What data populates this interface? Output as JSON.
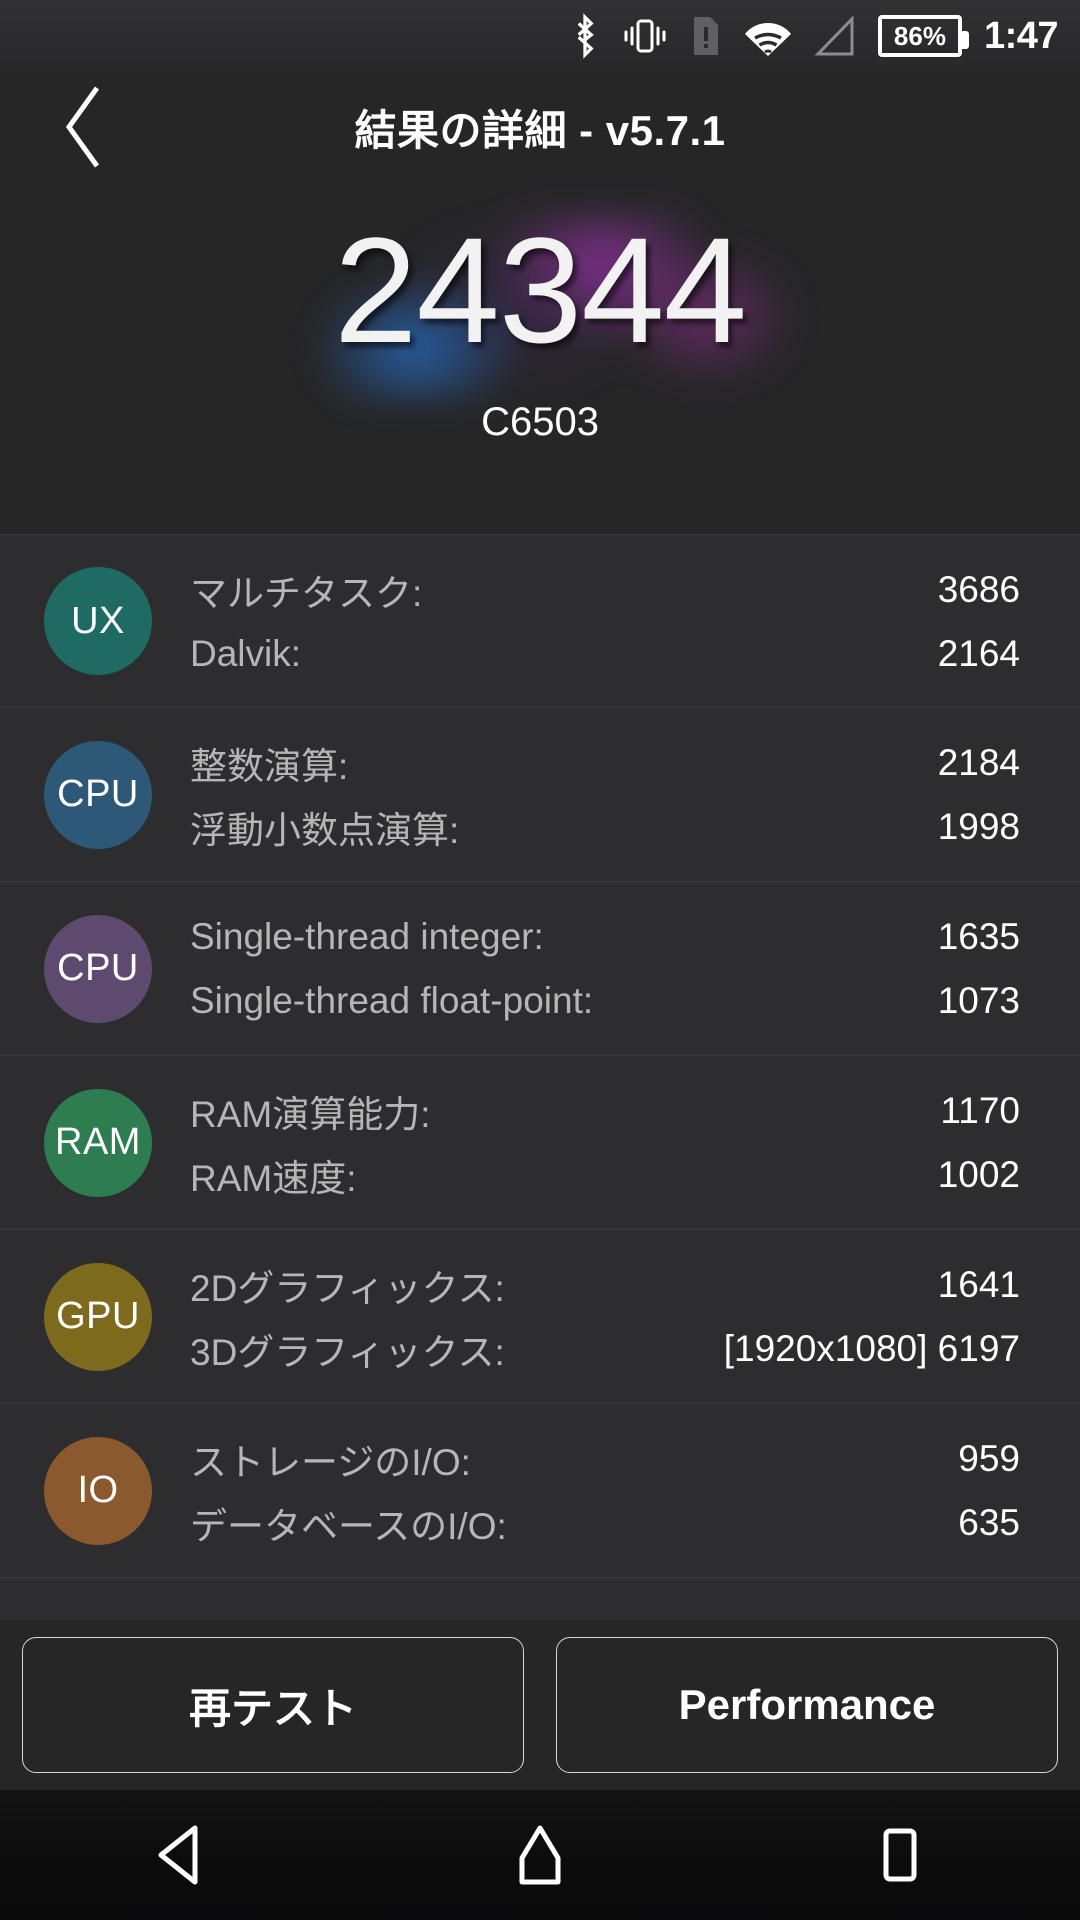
{
  "statusbar": {
    "icons": [
      "bluetooth-icon",
      "vibrate-icon",
      "sim-alert-icon",
      "wifi-icon",
      "signal-icon"
    ],
    "battery_percent": "86%",
    "clock": "1:47"
  },
  "header": {
    "back_label": "戻る",
    "title": "結果の詳細 - v5.7.1"
  },
  "hero": {
    "score": "24344",
    "device": "C6503",
    "glow_colors": [
      "#2660a8",
      "#80308c"
    ]
  },
  "results": [
    {
      "badge": "UX",
      "badge_color": "#1f6b63",
      "lines": [
        {
          "label": "マルチタスク:",
          "value": "3686"
        },
        {
          "label": "Dalvik:",
          "value": "2164"
        }
      ]
    },
    {
      "badge": "CPU",
      "badge_color": "#2e5878",
      "lines": [
        {
          "label": "整数演算:",
          "value": "2184"
        },
        {
          "label": "浮動小数点演算:",
          "value": "1998"
        }
      ]
    },
    {
      "badge": "CPU",
      "badge_color": "#5e4a6e",
      "lines": [
        {
          "label": "Single-thread integer:",
          "value": "1635"
        },
        {
          "label": "Single-thread float-point:",
          "value": "1073"
        }
      ]
    },
    {
      "badge": "RAM",
      "badge_color": "#2e7d51",
      "lines": [
        {
          "label": "RAM演算能力:",
          "value": "1170"
        },
        {
          "label": "RAM速度:",
          "value": "1002"
        }
      ]
    },
    {
      "badge": "GPU",
      "badge_color": "#7e6a1c",
      "lines": [
        {
          "label": "2Dグラフィックス:",
          "value": "1641"
        },
        {
          "label": "3Dグラフィックス:",
          "value": "[1920x1080] 6197"
        }
      ]
    },
    {
      "badge": "IO",
      "badge_color": "#8a5a2e",
      "lines": [
        {
          "label": "ストレージのI/O:",
          "value": "959"
        },
        {
          "label": "データベースのI/O:",
          "value": "635"
        }
      ]
    }
  ],
  "buttons": {
    "retest": "再テスト",
    "performance": "Performance"
  },
  "navbar": {
    "back": "back-icon",
    "home": "home-icon",
    "recents": "recents-icon"
  }
}
